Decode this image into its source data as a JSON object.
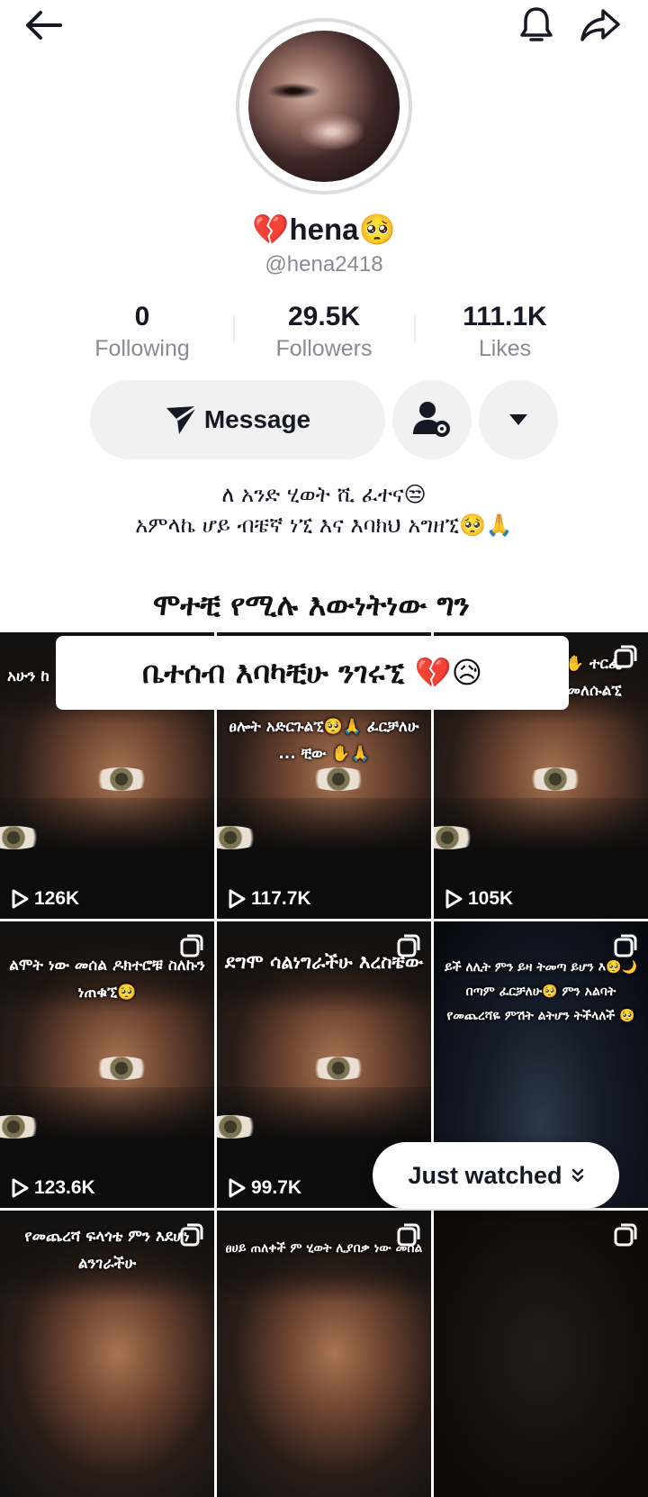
{
  "header": {
    "back_icon": "arrow-left-icon",
    "bell_icon": "bell-icon",
    "share_icon": "share-arrow-icon"
  },
  "profile": {
    "display_name": "💔hena🥺",
    "username": "@hena2418"
  },
  "stats": [
    {
      "value": "0",
      "label": "Following"
    },
    {
      "value": "29.5K",
      "label": "Followers"
    },
    {
      "value": "111.1K",
      "label": "Likes"
    }
  ],
  "actions": {
    "message_label": "Message",
    "add_friend_icon": "user-settings-icon",
    "more_icon": "caret-down-icon"
  },
  "bio": {
    "line1": "ለ አንድ ሂወት ሺ ፈተና😒",
    "line2": "አምላኬ ሆይ ብቼኛ ነኚ እና እባክህ አግዘኚ🥺🙏"
  },
  "caption": {
    "line1": "ሞተቺ የሚሉ እውነትነው ግን",
    "line2": "ቤተሰብ  እባካቺሁ ንገሩኚ 💔😥"
  },
  "videos": [
    {
      "text": "አሁን ከ ... 11 ...",
      "views": "126K"
    },
    {
      "text": "ፀሎት አድርጉልኚ🥺🙏 ፈርቻለሁ ... ቺው ✋🙏",
      "views": "117.7K"
    },
    {
      "text": "...ለሁ ...ለሁ🥺 ✋ ተርፌ ዶክተሮቹ ስለኩን ከመለሱልኚ",
      "views": "105K"
    },
    {
      "text": "ልሞት ነው መሰል ዶክተሮቹ ስለኩን ነጠቁኚ🥺",
      "views": "123.6K"
    },
    {
      "text": "ደግሞ ሳልነግራችሁ እረስቼው",
      "views": "99.7K"
    },
    {
      "text": "ይች ለሊት ምን ይዛ ትመጣ ይሆን እ🥺🌙 በጣም ፈርቻለሁ🥺 ምን አልባት የመጨረሻዬ ምሽት ልትሆን ትችላለች 🥺",
      "views": ""
    },
    {
      "text": "የመጨረሻ ፍላጎቴ ምን እደሆነ ልንገራችሁ",
      "views": ""
    },
    {
      "text": "ፀሀይ ጠለቀች ም ሂወት ሊያበቃ ነው መሰል",
      "views": ""
    },
    {
      "text": "",
      "views": ""
    }
  ],
  "just_watched": {
    "label": "Just watched",
    "icon": "chevron-double-down-icon"
  }
}
